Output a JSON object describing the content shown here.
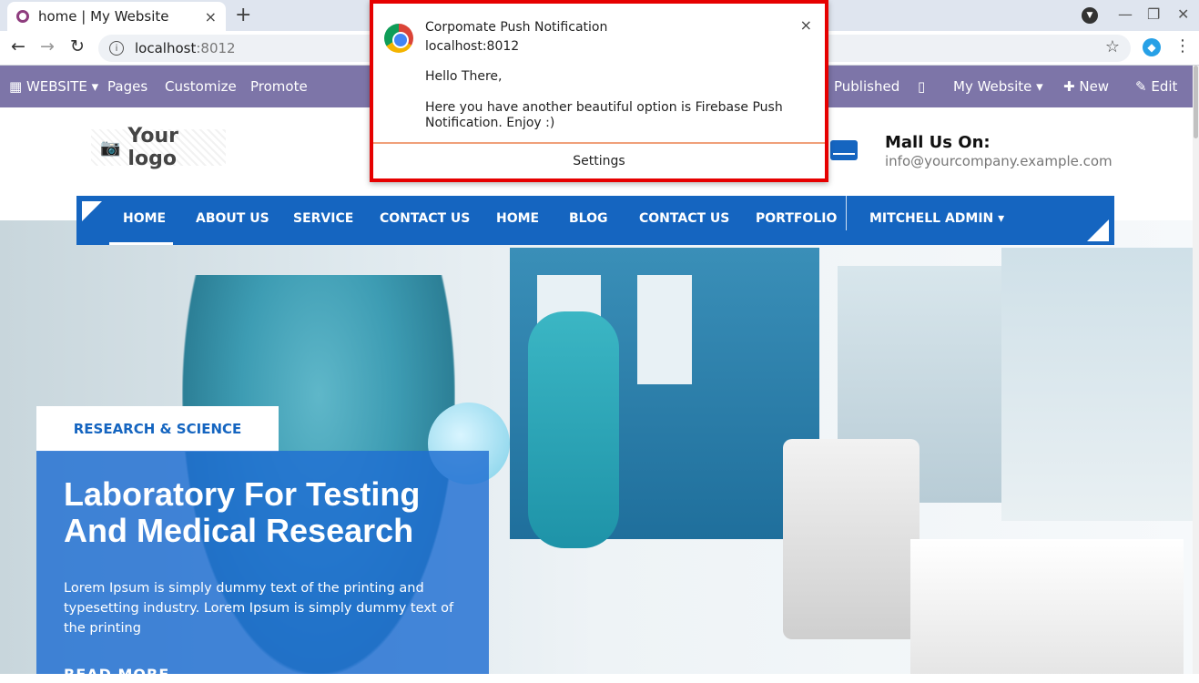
{
  "browser": {
    "tab_title": "home | My Website",
    "tab_close": "×",
    "new_tab": "+",
    "url_host": "localhost",
    "url_port": ":8012",
    "back": "←",
    "forward": "→",
    "reload": "↻",
    "star": "☆",
    "menu": "⋮",
    "min": "—",
    "max": "❐",
    "close": "✕",
    "profile": "▼"
  },
  "admin_bar": {
    "website": "WEBSITE",
    "pages": "Pages",
    "customize": "Customize",
    "promote": "Promote",
    "published": "Published",
    "my_website": "My Website",
    "new": "New",
    "edit": "Edit"
  },
  "header": {
    "logo_text": "Your logo",
    "mail_title": "Mall Us On:",
    "mail_address": "info@yourcompany.example.com"
  },
  "nav": {
    "items": [
      "HOME",
      "ABOUT US",
      "SERVICE",
      "CONTACT US",
      "HOME",
      "BLOG",
      "CONTACT US",
      "PORTFOLIO"
    ],
    "user": "MITCHELL ADMIN"
  },
  "hero": {
    "badge": "RESEARCH & SCIENCE",
    "title_line1": "Laboratory For Testing",
    "title_line2": "And Medical Research",
    "body": "Lorem Ipsum is simply dummy text of the printing and typesetting industry. Lorem Ipsum is simply dummy text of the printing",
    "read_more": "READ MORE"
  },
  "notification": {
    "app": "Corpomate Push Notification",
    "origin": "localhost:8012",
    "greeting": "Hello There,",
    "message": "Here you have another beautiful option is Firebase Push Notification. Enjoy :)",
    "settings": "Settings",
    "close": "×"
  },
  "colors": {
    "admin_bar": "#7d75a8",
    "nav_blue": "#1565c0",
    "highlight_border": "#e60000"
  }
}
